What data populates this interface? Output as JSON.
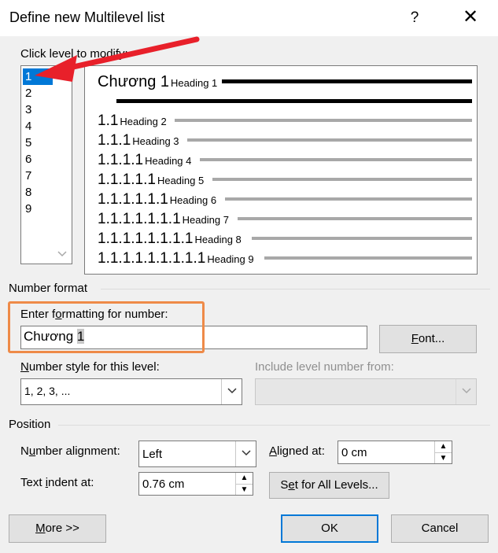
{
  "dialog": {
    "title": "Define new Multilevel list",
    "help_label": "?",
    "close_label": "✕"
  },
  "levels": {
    "label": "Click level to modify:",
    "items": [
      "1",
      "2",
      "3",
      "4",
      "5",
      "6",
      "7",
      "8",
      "9"
    ],
    "selected": "1"
  },
  "preview": {
    "rows": [
      {
        "num": "Chương 1",
        "heading": "Heading 1"
      },
      {
        "num": "1.1",
        "heading": "Heading 2"
      },
      {
        "num": "1.1.1",
        "heading": "Heading 3"
      },
      {
        "num": "1.1.1.1",
        "heading": "Heading 4"
      },
      {
        "num": "1.1.1.1.1",
        "heading": "Heading 5"
      },
      {
        "num": "1.1.1.1.1.1",
        "heading": "Heading 6"
      },
      {
        "num": "1.1.1.1.1.1.1",
        "heading": "Heading 7"
      },
      {
        "num": "1.1.1.1.1.1.1.1",
        "heading": "Heading 8"
      },
      {
        "num": "1.1.1.1.1.1.1.1.1",
        "heading": "Heading 9"
      }
    ]
  },
  "number_format": {
    "group_label": "Number format",
    "enter_label_pre": "Enter f",
    "enter_label_u": "o",
    "enter_label_post": "rmatting for number:",
    "value_prefix": "Chương ",
    "value_highlight": "1",
    "font_button_u": "F",
    "font_button_rest": "ont...",
    "style_label_u": "N",
    "style_label_rest": "umber style for this level:",
    "style_value": "1, 2, 3, ...",
    "include_label": "Include level number from:",
    "include_value": ""
  },
  "position": {
    "group_label": "Position",
    "alignment_label_pre": "N",
    "alignment_label_u": "u",
    "alignment_label_post": "mber alignment:",
    "alignment_value": "Left",
    "aligned_at_label_u": "A",
    "aligned_at_label_rest": "ligned at:",
    "aligned_at_value": "0 cm",
    "indent_label_pre": "Text ",
    "indent_label_u": "i",
    "indent_label_post": "ndent at:",
    "indent_value": "0.76 cm",
    "set_all_pre": "S",
    "set_all_u": "e",
    "set_all_post": "t for All Levels..."
  },
  "footer": {
    "more_u": "M",
    "more_rest": "ore >>",
    "ok_label": "OK",
    "cancel_label": "Cancel"
  },
  "colors": {
    "selection": "#0078d7",
    "annotation_arrow": "#e8202a",
    "annotation_box": "#ee8a48"
  }
}
